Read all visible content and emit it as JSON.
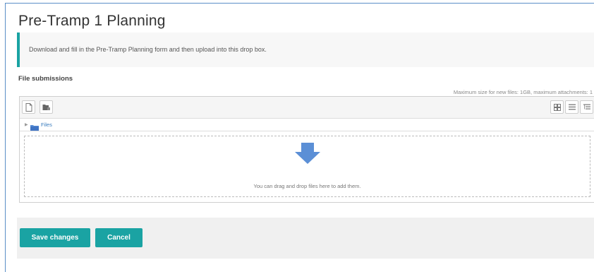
{
  "page": {
    "title": "Pre-Tramp 1 Planning",
    "intro": "Download and fill in the Pre-Tramp Planning form and then upload into this drop box."
  },
  "files": {
    "label": "File submissions",
    "max_size_note": "Maximum size for new files: 1GB, maximum attachments: 1",
    "path_root": "Files",
    "drop_text": "You can drag and drop files here to add them.",
    "icons": {
      "add_file": "add-file-icon",
      "create_folder": "create-folder-icon",
      "view_icons": "grid-view-icon",
      "view_list": "list-view-icon",
      "view_tree": "tree-view-icon",
      "folder": "folder-icon",
      "drop_arrow": "down-arrow-icon"
    }
  },
  "actions": {
    "save_label": "Save changes",
    "cancel_label": "Cancel"
  },
  "colors": {
    "accent": "#1aa3a3",
    "arrow": "#5b8fd6",
    "link": "#3a7dbf"
  }
}
